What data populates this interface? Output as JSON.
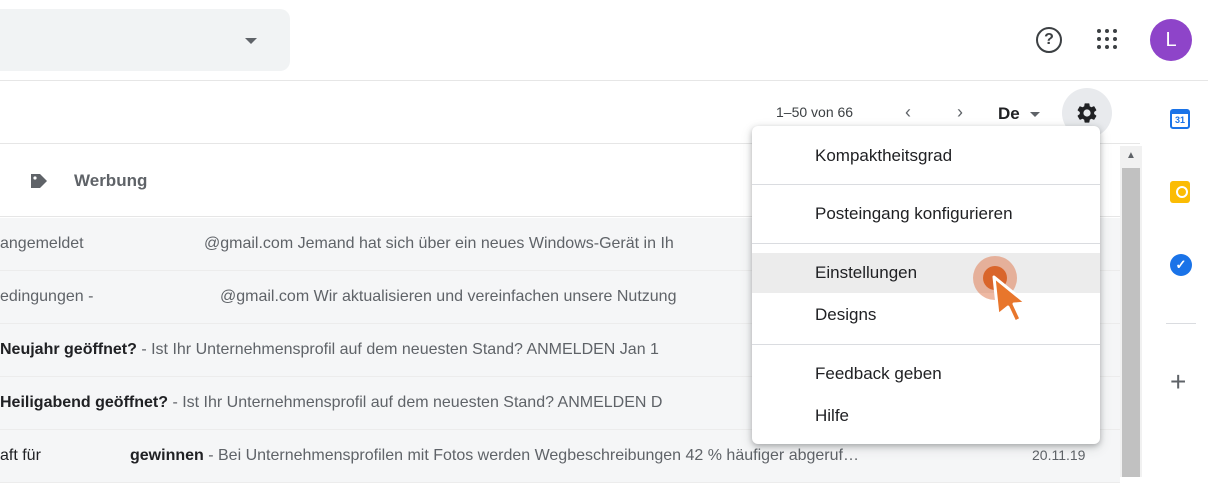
{
  "header": {
    "help_icon_glyph": "?",
    "avatar_letter": "L",
    "avatar_color": "#8e44c9"
  },
  "toolbar": {
    "pager_text": "1–50 von 66",
    "prev_glyph": "‹",
    "next_glyph": "›",
    "input_language": "De"
  },
  "category": {
    "label": "Werbung"
  },
  "rows": [
    {
      "sender": "angemeldet",
      "subject": "",
      "snippet": "@gmail.com Jemand hat sich über ein neues Windows-Gerät in Ih",
      "date": ""
    },
    {
      "sender": "edingungen -",
      "subject": "",
      "snippet": "@gmail.com Wir aktualisieren und vereinfachen unsere Nutzung",
      "date": ""
    },
    {
      "sender": "",
      "subject": "Neujahr geöffnet?",
      "snippet": " - Ist Ihr Unternehmensprofil auf dem neuesten Stand? ANMELDEN Jan 1",
      "date": ""
    },
    {
      "sender": "",
      "subject": "Heiligabend geöffnet?",
      "snippet": " - Ist Ihr Unternehmensprofil auf dem neuesten Stand? ANMELDEN D",
      "date": ""
    },
    {
      "sender": "aft für",
      "subject": "gewinnen",
      "snippet": " - Bei Unternehmensprofilen mit Fotos werden Wegbeschreibungen 42 % häufiger abgeruf…",
      "date": "20.11.19"
    }
  ],
  "settings_menu": {
    "items": [
      {
        "label": "Kompaktheitsgrad"
      },
      {
        "label": "Posteingang konfigurieren"
      },
      {
        "label": "Einstellungen"
      },
      {
        "label": "Designs"
      },
      {
        "label": "Feedback geben"
      },
      {
        "label": "Hilfe"
      }
    ]
  },
  "right_rail": {
    "calendar_label": "31",
    "add_glyph": "+"
  },
  "colors": {
    "accent_blue": "#1a73e8",
    "keep_yellow": "#fbbc04",
    "cursor_orange": "#d9652b"
  }
}
